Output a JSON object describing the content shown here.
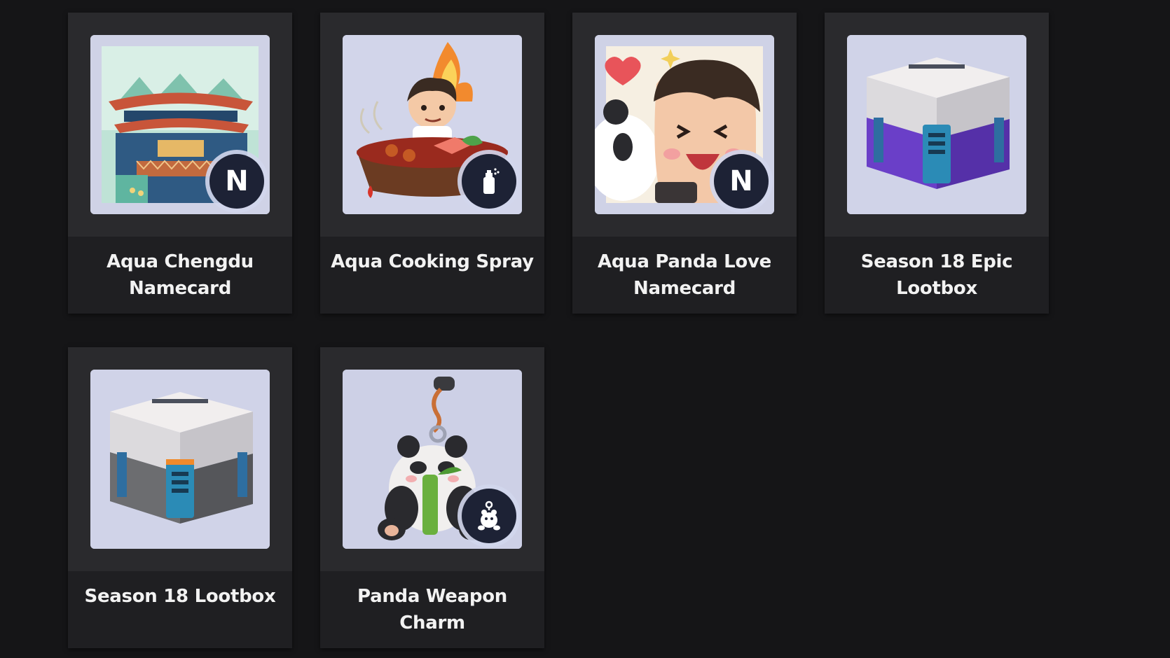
{
  "items": [
    {
      "name": "Aqua Chengdu Namecard",
      "badge": "namecard",
      "badge_letter": "N",
      "image": "chengdu-pagoda-artwork"
    },
    {
      "name": "Aqua Cooking Spray",
      "badge": "spray",
      "badge_letter": "",
      "image": "hotpot-cooking-artwork"
    },
    {
      "name": "Aqua Panda Love Namecard",
      "badge": "namecard",
      "badge_letter": "N",
      "image": "panda-love-artwork"
    },
    {
      "name": "Season 18 Epic Lootbox",
      "badge": "",
      "badge_letter": "",
      "image": "epic-lootbox-purple"
    },
    {
      "name": "Season 18 Lootbox",
      "badge": "",
      "badge_letter": "",
      "image": "lootbox-gray"
    },
    {
      "name": "Panda Weapon Charm",
      "badge": "weapon-charm",
      "badge_letter": "",
      "image": "panda-charm-artwork"
    }
  ],
  "colors": {
    "page_bg": "#151517",
    "card_bg": "#1f1f22",
    "thumb_bg": "#c9cce2",
    "badge_bg": "#1d2235",
    "title_text": "#f2f2f2"
  }
}
